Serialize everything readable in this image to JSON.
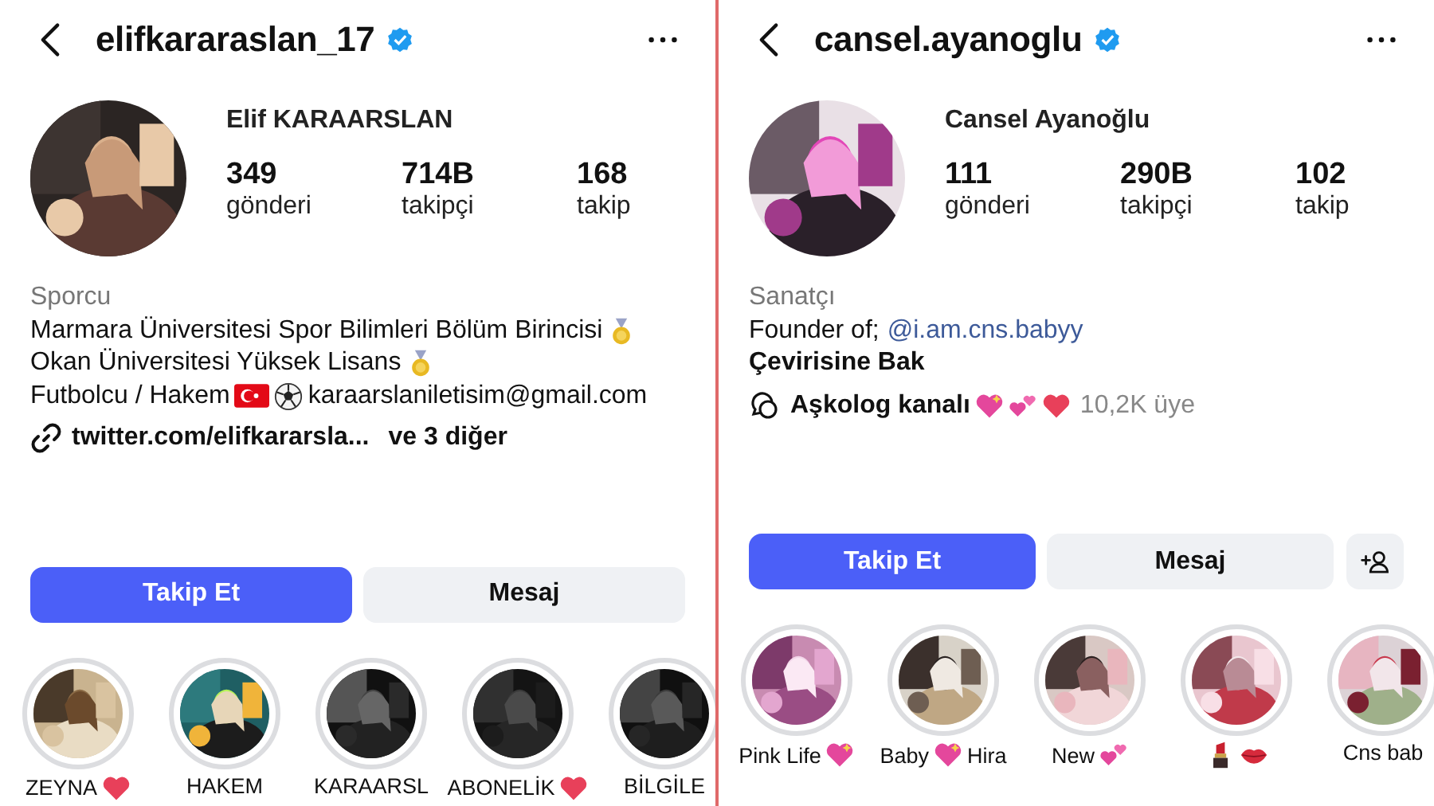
{
  "panels": [
    {
      "header": {
        "username": "elifkararaslan_17",
        "verified": true
      },
      "avatar": {
        "kind": "picture"
      },
      "name": "Elif KARAARSLAN",
      "stats": [
        {
          "value": "349",
          "label": "gönderi"
        },
        {
          "value": "714B",
          "label": "takipçi"
        },
        {
          "value": "168",
          "label": "takip"
        }
      ],
      "category": "Sporcu",
      "bio": [
        [
          {
            "kind": "text",
            "text": "Marmara Üniversitesi Spor Bilimleri Bölüm Birincisi"
          },
          {
            "kind": "medal"
          }
        ],
        [
          {
            "kind": "text",
            "text": "Okan Üniversitesi Yüksek Lisans"
          },
          {
            "kind": "medal"
          }
        ],
        [
          {
            "kind": "text",
            "text": "Futbolcu / Hakem"
          },
          {
            "kind": "flag"
          },
          {
            "kind": "ball"
          },
          {
            "kind": "text",
            "text": "karaarslaniletisim@gmail.com"
          }
        ]
      ],
      "extra": {
        "kind": "link",
        "text": "twitter.com/elifkararsla...",
        "more": "ve 3 diğer"
      },
      "buttons": [
        {
          "kind": "follow",
          "label": "Takip Et"
        },
        {
          "kind": "message",
          "label": "Mesaj"
        }
      ],
      "highlights": [
        {
          "label": [
            {
              "kind": "text",
              "text": "ZEYNA"
            },
            {
              "kind": "heart"
            }
          ]
        },
        {
          "label": [
            {
              "kind": "text",
              "text": "HAKEM"
            }
          ]
        },
        {
          "label": [
            {
              "kind": "text",
              "text": "KARAARSL"
            }
          ]
        },
        {
          "label": [
            {
              "kind": "text",
              "text": "ABONELİK"
            },
            {
              "kind": "heart"
            }
          ]
        },
        {
          "label": [
            {
              "kind": "text",
              "text": "BİLGİLE"
            }
          ]
        }
      ]
    },
    {
      "header": {
        "username": "cansel.ayanoglu",
        "verified": true
      },
      "avatar": {
        "kind": "picture"
      },
      "name": "Cansel Ayanoğlu",
      "stats": [
        {
          "value": "111",
          "label": "gönderi"
        },
        {
          "value": "290B",
          "label": "takipçi"
        },
        {
          "value": "102",
          "label": "takip"
        }
      ],
      "category": "Sanatçı",
      "bio": [
        [
          {
            "kind": "text",
            "text": "Founder of;"
          },
          {
            "kind": "mention",
            "text": "@i.am.cns.babyy"
          }
        ],
        [
          {
            "kind": "action",
            "text": "Çevirisine Bak"
          }
        ]
      ],
      "extra": {
        "kind": "channel",
        "text": "Aşkolog kanalı",
        "icons": [
          {
            "kind": "sparkle-heart"
          },
          {
            "kind": "hearts"
          },
          {
            "kind": "heart"
          }
        ],
        "more": "10,2K üye"
      },
      "buttons": [
        {
          "kind": "follow",
          "label": "Takip Et"
        },
        {
          "kind": "message",
          "label": "Mesaj"
        },
        {
          "kind": "add-person"
        }
      ],
      "highlights": [
        {
          "label": [
            {
              "kind": "text",
              "text": "Pink Life"
            },
            {
              "kind": "sparkle-heart"
            }
          ]
        },
        {
          "label": [
            {
              "kind": "text",
              "text": "Baby"
            },
            {
              "kind": "sparkle-heart"
            },
            {
              "kind": "text",
              "text": "Hira"
            }
          ]
        },
        {
          "label": [
            {
              "kind": "text",
              "text": "New"
            },
            {
              "kind": "hearts"
            }
          ]
        },
        {
          "label": [
            {
              "kind": "lipstick"
            },
            {
              "kind": "lips"
            }
          ]
        },
        {
          "label": [
            {
              "kind": "text",
              "text": "Cns bab"
            }
          ]
        }
      ]
    }
  ]
}
